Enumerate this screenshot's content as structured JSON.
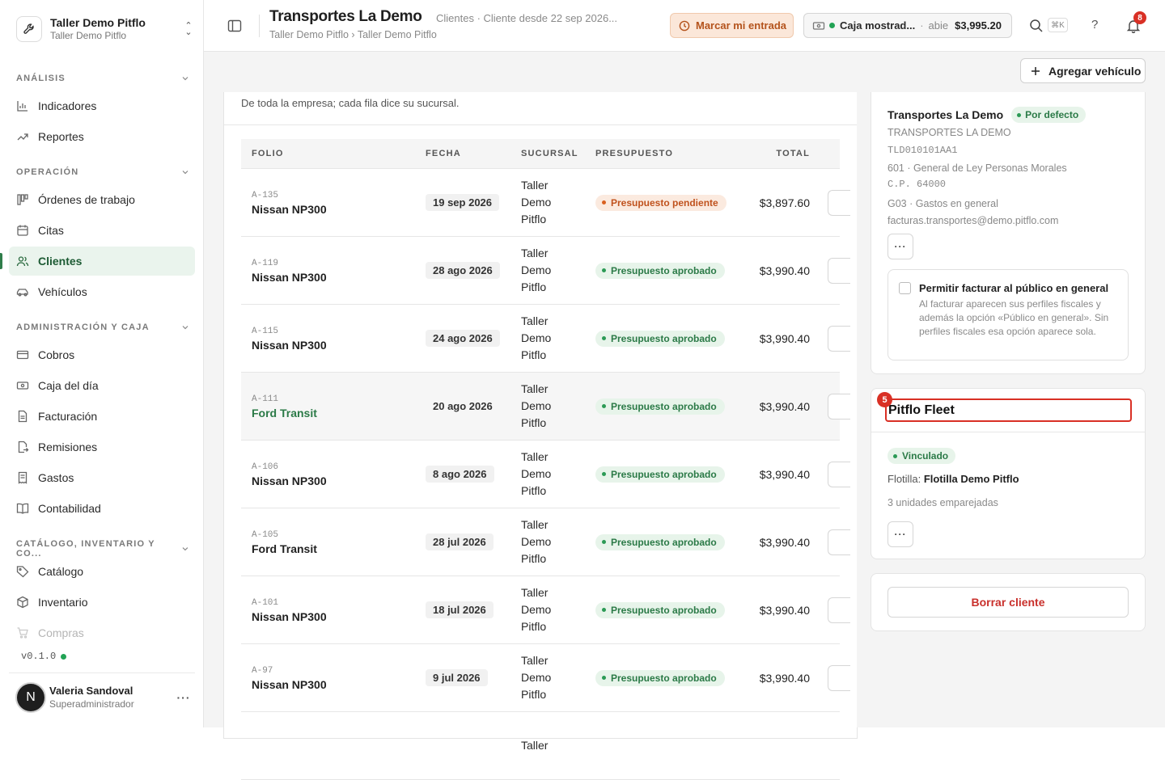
{
  "org": {
    "name": "Taller Demo Pitflo",
    "sub": "Taller Demo Pitflo",
    "logo_icon": "wrench-icon",
    "chevron_icon": "chevron-updown-icon"
  },
  "sidebar": {
    "sections": [
      {
        "label": "ANÁLISIS",
        "items": [
          {
            "label": "Indicadores",
            "icon": "bar-chart-icon"
          },
          {
            "label": "Reportes",
            "icon": "trending-icon"
          }
        ]
      },
      {
        "label": "OPERACIÓN",
        "items": [
          {
            "label": "Órdenes de trabajo",
            "icon": "kanban-icon"
          },
          {
            "label": "Citas",
            "icon": "calendar-icon"
          },
          {
            "label": "Clientes",
            "icon": "users-icon",
            "active": true
          },
          {
            "label": "Vehículos",
            "icon": "car-icon"
          }
        ]
      },
      {
        "label": "ADMINISTRACIÓN Y CAJA",
        "items": [
          {
            "label": "Cobros",
            "icon": "card-icon"
          },
          {
            "label": "Caja del día",
            "icon": "cash-icon"
          },
          {
            "label": "Facturación",
            "icon": "document-icon"
          },
          {
            "label": "Remisiones",
            "icon": "file-export-icon"
          },
          {
            "label": "Gastos",
            "icon": "receipt-icon"
          },
          {
            "label": "Contabilidad",
            "icon": "book-icon"
          }
        ]
      },
      {
        "label": "CATÁLOGO, INVENTARIO Y CO...",
        "items": [
          {
            "label": "Catálogo",
            "icon": "tag-icon"
          },
          {
            "label": "Inventario",
            "icon": "box-icon"
          },
          {
            "label": "Compras",
            "icon": "cart-icon"
          }
        ]
      }
    ],
    "version": "v0.1.0",
    "user": {
      "initial": "N",
      "name": "Valeria Sandoval",
      "role": "Superadministrador"
    }
  },
  "topbar": {
    "title": "Transportes La Demo",
    "meta": "Clientes · Cliente desde 22 sep 2026...",
    "breadcrumb": "Taller Demo Pitflo › Taller Demo Pitflo",
    "clock_label": "Marcar mi entrada",
    "cash": {
      "name": "Caja mostrad...",
      "status": "abie",
      "amount": "$3,995.20"
    },
    "kbd": "⌘K",
    "help": "?",
    "notifications": "8"
  },
  "main": {
    "add_vehicle": "Agregar vehículo",
    "note": "De toda la empresa; cada fila dice su sucursal.",
    "columns": [
      "FOLIO",
      "FECHA",
      "SUCURSAL",
      "PRESUPUESTO",
      "TOTAL"
    ],
    "rows": [
      {
        "folio": "A-135",
        "vehicle": "Nissan NP300",
        "date": "19 sep 2026",
        "branch": [
          "Taller",
          "Demo",
          "Pitflo"
        ],
        "status": "Presupuesto pendiente",
        "status_type": "pending",
        "total": "$3,897.60"
      },
      {
        "folio": "A-119",
        "vehicle": "Nissan NP300",
        "date": "28 ago 2026",
        "branch": [
          "Taller",
          "Demo",
          "Pitflo"
        ],
        "status": "Presupuesto aprobado",
        "status_type": "approved",
        "total": "$3,990.40"
      },
      {
        "folio": "A-115",
        "vehicle": "Nissan NP300",
        "date": "24 ago 2026",
        "branch": [
          "Taller",
          "Demo",
          "Pitflo"
        ],
        "status": "Presupuesto aprobado",
        "status_type": "approved",
        "total": "$3,990.40"
      },
      {
        "folio": "A-111",
        "vehicle": "Ford Transit",
        "date": "20 ago 2026",
        "branch": [
          "Taller",
          "Demo",
          "Pitflo"
        ],
        "status": "Presupuesto aprobado",
        "status_type": "approved",
        "total": "$3,990.40",
        "highlight": true
      },
      {
        "folio": "A-106",
        "vehicle": "Nissan NP300",
        "date": "8 ago 2026",
        "branch": [
          "Taller",
          "Demo",
          "Pitflo"
        ],
        "status": "Presupuesto aprobado",
        "status_type": "approved",
        "total": "$3,990.40"
      },
      {
        "folio": "A-105",
        "vehicle": "Ford Transit",
        "date": "28 jul 2026",
        "branch": [
          "Taller",
          "Demo",
          "Pitflo"
        ],
        "status": "Presupuesto aprobado",
        "status_type": "approved",
        "total": "$3,990.40"
      },
      {
        "folio": "A-101",
        "vehicle": "Nissan NP300",
        "date": "18 jul 2026",
        "branch": [
          "Taller",
          "Demo",
          "Pitflo"
        ],
        "status": "Presupuesto aprobado",
        "status_type": "approved",
        "total": "$3,990.40"
      },
      {
        "folio": "A-97",
        "vehicle": "Nissan NP300",
        "date": "9 jul 2026",
        "branch": [
          "Taller",
          "Demo",
          "Pitflo"
        ],
        "status": "Presupuesto aprobado",
        "status_type": "approved",
        "total": "$3,990.40"
      },
      {
        "folio": "",
        "vehicle": "",
        "date": "",
        "branch": [
          "Taller",
          "",
          ""
        ],
        "status": "",
        "status_type": "",
        "total": ""
      }
    ]
  },
  "profile": {
    "name": "Transportes La Demo",
    "default_label": "Por defecto",
    "legal_name": "TRANSPORTES LA DEMO",
    "rfc": "TLD010101AA1",
    "regime": "601 · General de Ley Personas Morales",
    "cp": "C.P. 64000",
    "cfdi_use": "G03 · Gastos en general",
    "email": "facturas.transportes@demo.pitflo.com",
    "permit_title": "Permitir facturar al público en general",
    "permit_desc": "Al facturar aparecen sus perfiles fiscales y además la opción «Público en general». Sin perfiles fiscales esa opción aparece sola."
  },
  "fleet": {
    "input_value": "Pitflo Fleet",
    "badge": "5",
    "linked_label": "Vinculado",
    "fleet_prefix": "Flotilla:",
    "fleet_name": "Flotilla Demo Pitflo",
    "units": "3 unidades emparejadas"
  },
  "delete_label": "Borrar cliente",
  "colors": {
    "accent_green": "#2b7a47",
    "danger": "#d93025",
    "warning": "#c0521d"
  }
}
